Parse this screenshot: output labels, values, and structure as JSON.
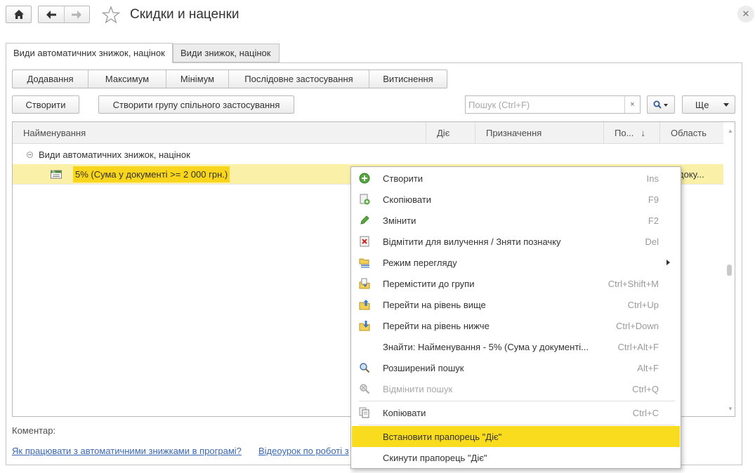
{
  "window": {
    "title": "Скидки и наценки"
  },
  "tabs": [
    {
      "label": "Види автоматичних знижок, націнок",
      "active": true
    },
    {
      "label": "Види знижок, націнок",
      "active": false
    }
  ],
  "segments": [
    "Додавання",
    "Максимум",
    "Мінімум",
    "Послідовне застосування",
    "Витиснення"
  ],
  "toolbar": {
    "create_label": "Створити",
    "create_group_label": "Створити групу спільного застосування",
    "search_placeholder": "Пошук (Ctrl+F)",
    "clear_symbol": "×",
    "more_label": "Ще"
  },
  "table": {
    "columns": [
      "Найменування",
      "Діє",
      "Призначення",
      "По...",
      "Область"
    ],
    "sort_indicator": "↓",
    "group_row": "Види автоматичних знижок, націнок",
    "rows": [
      {
        "name": "5% (Сума у документі >= 2 000 грн.)",
        "area": "доку..."
      }
    ]
  },
  "comment_label": "Коментар:",
  "links": [
    "Як працювати з автоматичними знижками в програмі?",
    "Відеоурок по роботі з"
  ],
  "context_menu": {
    "items": [
      {
        "label": "Створити",
        "shortcut": "Ins",
        "icon": "add-icon"
      },
      {
        "label": "Скопіювати",
        "shortcut": "F9",
        "icon": "copy-item-icon"
      },
      {
        "label": "Змінити",
        "shortcut": "F2",
        "icon": "pencil-icon"
      },
      {
        "label": "Відмітити для вилучення / Зняти позначку",
        "shortcut": "Del",
        "icon": "delete-mark-icon"
      },
      {
        "label": "Режим перегляду",
        "shortcut": "",
        "icon": "view-mode-icon",
        "submenu": true
      },
      {
        "label": "Перемістити до групи",
        "shortcut": "Ctrl+Shift+M",
        "icon": "move-to-group-icon"
      },
      {
        "label": "Перейти на рівень вище",
        "shortcut": "Ctrl+Up",
        "icon": "level-up-icon"
      },
      {
        "label": "Перейти на рівень нижче",
        "shortcut": "Ctrl+Down",
        "icon": "level-down-icon"
      },
      {
        "label": "Знайти: Найменування - 5% (Сума у документі...",
        "shortcut": "Ctrl+Alt+F",
        "icon": ""
      },
      {
        "label": "Розширений пошук",
        "shortcut": "Alt+F",
        "icon": "search-icon"
      },
      {
        "label": "Відмінити пошук",
        "shortcut": "Ctrl+Q",
        "icon": "cancel-search-icon",
        "disabled": true
      },
      {
        "label": "Копіювати",
        "shortcut": "Ctrl+C",
        "icon": "copy-icon"
      },
      {
        "label": "Встановити прапорець \"Діє\"",
        "shortcut": "",
        "icon": "",
        "highlighted": true
      },
      {
        "label": "Скинути прапорець \"Діє\"",
        "shortcut": "",
        "icon": ""
      }
    ]
  },
  "colors": {
    "highlight": "#f9d51c",
    "row_selected": "#fbf0a8",
    "link": "#3a68b5"
  }
}
